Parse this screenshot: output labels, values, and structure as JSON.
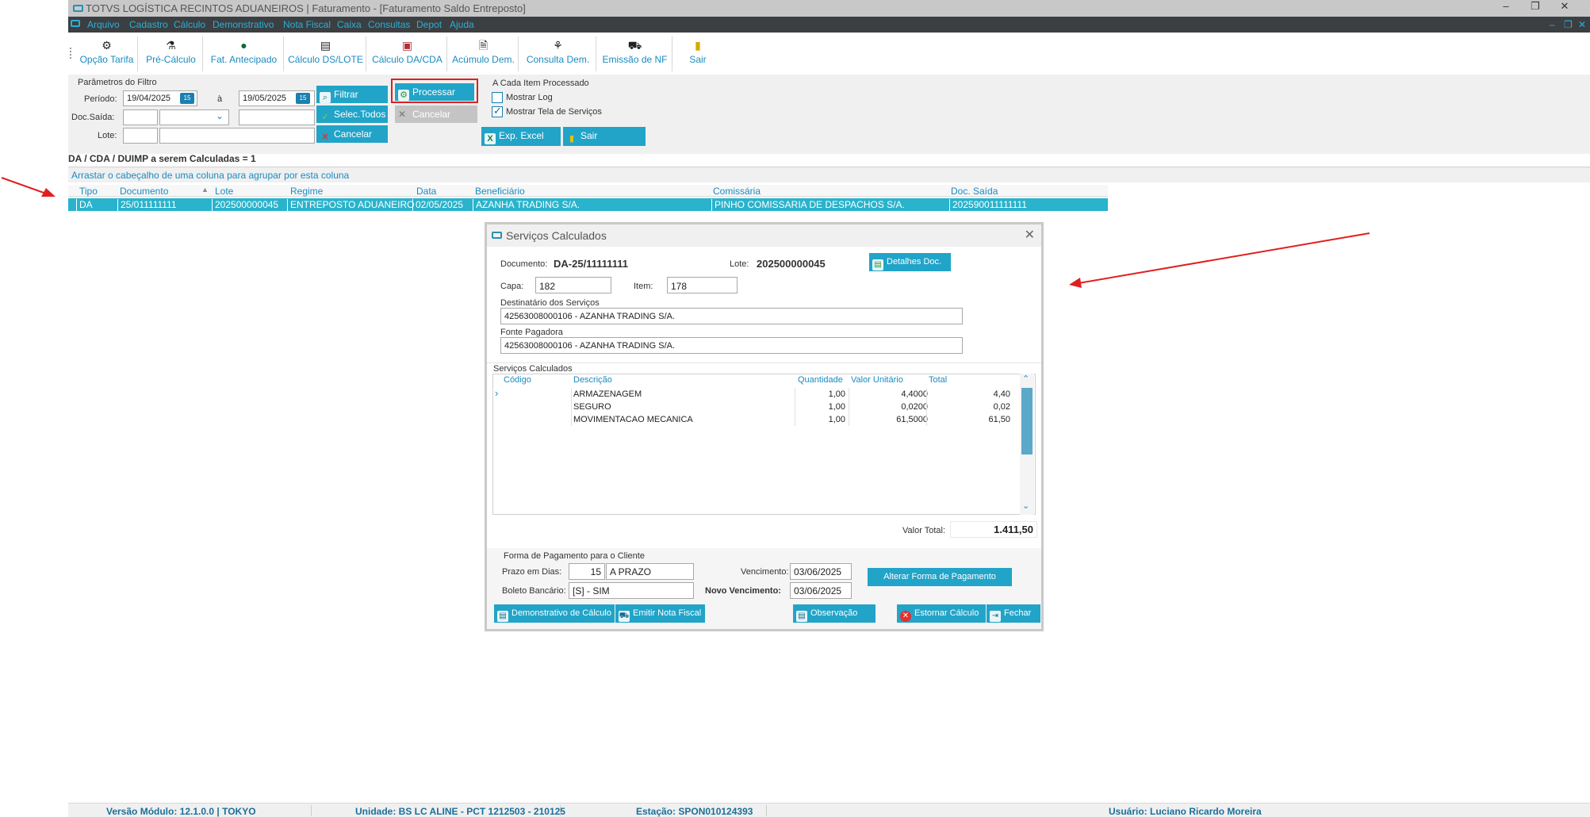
{
  "window": {
    "title": "TOTVS LOGÍSTICA RECINTOS ADUANEIROS | Faturamento - [Faturamento Saldo Entreposto]",
    "controls": [
      "‒",
      "❐",
      "✕"
    ]
  },
  "menu": {
    "items": [
      "Arquivo",
      "Cadastro",
      "Cálculo",
      "Demonstrativo",
      "Nota Fiscal",
      "Caixa",
      "Consultas",
      "Depot",
      "Ajuda"
    ],
    "mdi_controls": [
      "‒",
      "❐",
      "✕"
    ]
  },
  "toolbar": {
    "items": [
      {
        "label": "Opção Tarifa",
        "icon": "tariff-option-icon"
      },
      {
        "label": "Pré-Cálculo",
        "icon": "pre-calc-icon"
      },
      {
        "label": "Fat. Antecipado",
        "icon": "advance-billing-icon"
      },
      {
        "label": "Cálculo DS/LOTE",
        "icon": "calculator-icon"
      },
      {
        "label": "Cálculo DA/CDA",
        "icon": "calc-da-icon"
      },
      {
        "label": "Acúmulo Dem.",
        "icon": "accumulate-icon"
      },
      {
        "label": "Consulta Dem.",
        "icon": "query-icon"
      },
      {
        "label": "Emissão de NF",
        "icon": "truck-icon"
      },
      {
        "label": "Sair",
        "icon": "exit-door-icon"
      }
    ]
  },
  "filter": {
    "group_label": "Parâmetros do Filtro",
    "periodo_label": "Período:",
    "periodo_from": "19/04/2025",
    "periodo_sep": "à",
    "periodo_to": "19/05/2025",
    "calendar_icon_text": "15",
    "docsaida_label": "Doc.Saída:",
    "lote_label": "Lote:",
    "btn_filtrar": "Filtrar",
    "btn_selec_todos": "Selec.Todos",
    "btn_cancelar": "Cancelar",
    "btn_processar": "Processar",
    "btn_cancelar2": "Cancelar",
    "each_item_label": "A Cada Item Processado",
    "mostrar_log": "Mostrar Log",
    "mostrar_tela": "Mostrar Tela de Serviços",
    "btn_exp_excel": "Exp. Excel",
    "btn_sair": "Sair"
  },
  "grid": {
    "title": "DA / CDA / DUIMP a serem Calculadas = 1",
    "group_hint": "Arrastar o cabeçalho de uma coluna para agrupar por esta coluna",
    "columns": [
      "Tipo",
      "Documento",
      "Lote",
      "Regime",
      "Data",
      "Beneficiário",
      "Comissária",
      "Doc. Saída"
    ],
    "rows": [
      [
        "DA",
        "25/011111111",
        "202500000045",
        "ENTREPOSTO ADUANEIRO",
        "02/05/2025",
        "AZANHA TRADING S/A.",
        "PINHO COMISSARIA DE DESPACHOS S/A.",
        "202590011111111"
      ]
    ]
  },
  "dialog": {
    "title": "Serviços Calculados",
    "documento_label": "Documento:",
    "documento_value": "DA-25/11111111",
    "lote_label": "Lote:",
    "lote_value": "202500000045",
    "btn_detalhes": "Detalhes Doc.",
    "capa_label": "Capa:",
    "capa_value": "182",
    "item_label": "Item:",
    "item_value": "178",
    "destinatario_label": "Destinatário dos Serviços",
    "destinatario_value": "42563008000106 - AZANHA TRADING S/A.",
    "fonte_label": "Fonte Pagadora",
    "fonte_value": "42563008000106 - AZANHA TRADING S/A.",
    "servicos_label": "Serviços Calculados",
    "svc_columns": [
      "Código",
      "Descrição",
      "Quantidade",
      "Valor Unitário",
      "Total"
    ],
    "svc_rows": [
      [
        "",
        "ARMAZENAGEM",
        "1,00",
        "4,4000",
        "4,40"
      ],
      [
        "",
        "SEGURO",
        "1,00",
        "0,0200",
        "0,02"
      ],
      [
        "",
        "MOVIMENTACAO MECANICA",
        "1,00",
        "61,5000",
        "61,50"
      ]
    ],
    "valor_total_label": "Valor Total:",
    "valor_total": "1.411,50",
    "forma_pag_label": "Forma de Pagamento para o Cliente",
    "prazo_label": "Prazo em  Dias:",
    "prazo_dias": "15",
    "prazo_desc": "A PRAZO",
    "boleto_label": "Boleto Bancário:",
    "boleto_value": "[S] - SIM",
    "vencimento_label": "Vencimento:",
    "vencimento_value": "03/06/2025",
    "novo_venc_label": "Novo Vencimento:",
    "novo_venc_value": "03/06/2025",
    "btn_alterar": "Alterar Forma de Pagamento",
    "btn_demonstrativo": "Demonstrativo de Cálculo",
    "btn_emitir_nf": "Emitir Nota Fiscal",
    "btn_observacao": "Observação",
    "btn_estornar": "Estornar Cálculo",
    "btn_fechar": "Fechar"
  },
  "status": {
    "versao": "Versão Módulo:  12.1.0.0  |  TOKYO",
    "unidade": "Unidade: BS LC ALINE - PCT 1212503 - 210125",
    "estacao": "Estação: SPON010124393",
    "usuario": "Usuário: Luciano Ricardo Moreira"
  },
  "colors": {
    "accent": "#21a4c8",
    "menubar": "#3b3f42",
    "selected_row": "#29b3cc",
    "highlight_border": "#e02020",
    "arrow": "#e02020"
  }
}
